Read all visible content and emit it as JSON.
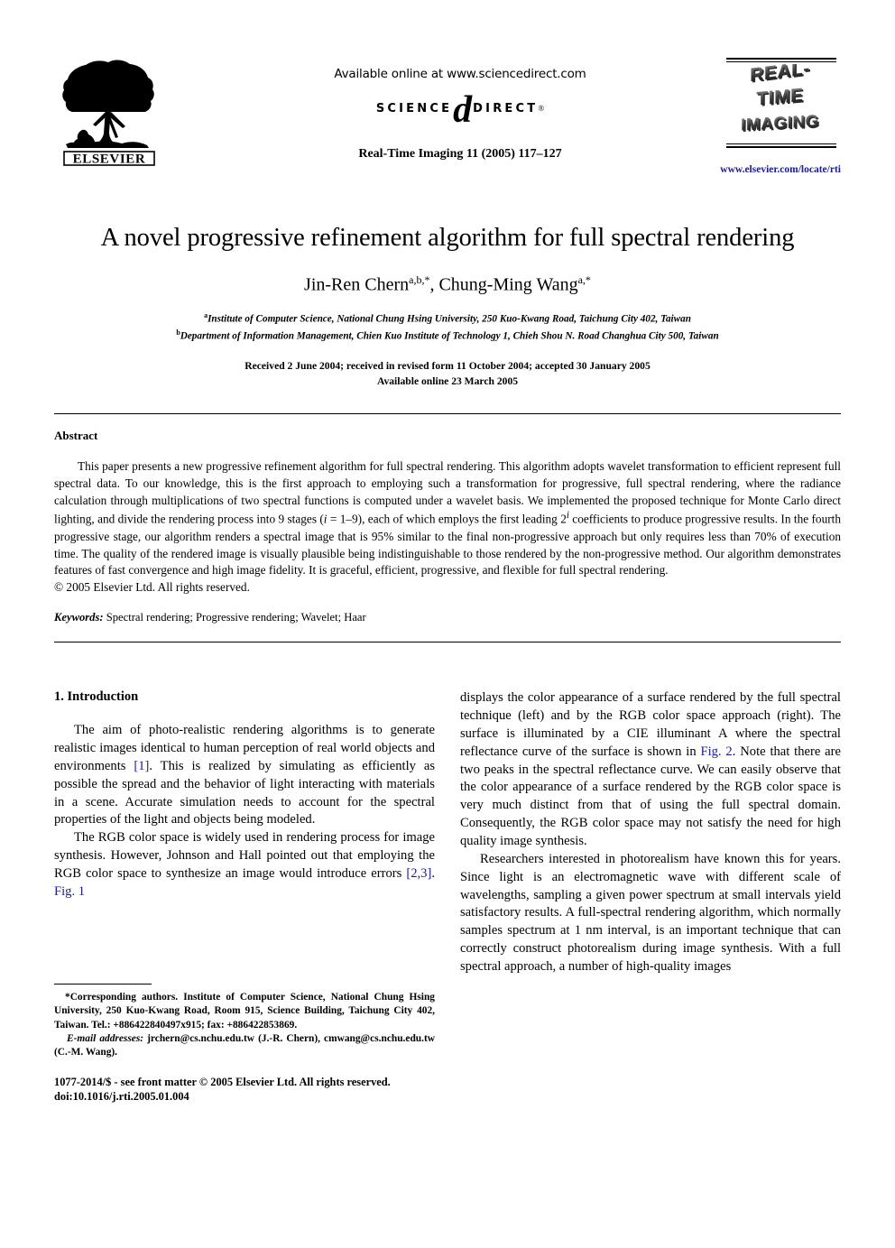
{
  "header": {
    "available_online": "Available online at www.sciencedirect.com",
    "sciencedirect_left": "SCIENCE",
    "sciencedirect_d": "d",
    "sciencedirect_right": "DIRECT",
    "sciencedirect_reg": "®",
    "journal_reference": "Real-Time Imaging 11 (2005) 117–127",
    "elsevier_wordmark": "ELSEVIER",
    "journal_logo_lines": [
      "REAL-",
      "TIME",
      "IMAGING"
    ],
    "journal_url": "www.elsevier.com/locate/rti",
    "link_color": "#1a1aa6"
  },
  "article": {
    "title": "A novel progressive refinement algorithm for full spectral rendering",
    "authors_plain": "Jin-Ren Chern",
    "authors": [
      {
        "name": "Jin-Ren Chern",
        "sup": "a,b,*"
      },
      {
        "name": "Chung-Ming Wang",
        "sup": "a,*"
      }
    ],
    "affiliations": [
      {
        "marker": "a",
        "text": "Institute of Computer Science, National Chung Hsing University, 250 Kuo-Kwang Road, Taichung City 402, Taiwan"
      },
      {
        "marker": "b",
        "text": "Department of Information Management, Chien Kuo Institute of Technology 1, Chieh Shou N. Road Changhua City 500, Taiwan"
      }
    ],
    "received_line": "Received 2 June 2004; received in revised form 11 October 2004; accepted 30 January 2005",
    "available_line": "Available online 23 March 2005"
  },
  "abstract": {
    "heading": "Abstract",
    "part1": "This paper presents a new progressive refinement algorithm for full spectral rendering. This algorithm adopts wavelet transformation to efficient represent full spectral data. To our knowledge, this is the first approach to employing such a transformation for progressive, full spectral rendering, where the radiance calculation through multiplications of two spectral functions is computed under a wavelet basis. We implemented the proposed technique for Monte Carlo direct lighting, and divide the rendering process into 9 stages (",
    "math_i": "i",
    "math_eq": " = 1–9), each of which employs the first leading 2",
    "math_sup": "i",
    "part2": " coefficients to produce progressive results. In the fourth progressive stage, our algorithm renders a spectral image that is 95% similar to the final non-progressive approach but only requires less than 70% of execution time. The quality of the rendered image is visually plausible being indistinguishable to those rendered by the non-progressive method. Our algorithm demonstrates features of fast convergence and high image fidelity. It is graceful, efficient, progressive, and flexible for full spectral rendering.",
    "copyright": "© 2005 Elsevier Ltd. All rights reserved.",
    "keywords_label": "Keywords:",
    "keywords_value": "Spectral rendering; Progressive rendering; Wavelet; Haar"
  },
  "body": {
    "section_heading": "1. Introduction",
    "left_column": {
      "para1_a": "The aim of photo-realistic rendering algorithms is to generate realistic images identical to human perception of real world objects and environments ",
      "para1_ref": "[1]",
      "para1_b": ". This is realized by simulating as efficiently as possible the spread and the behavior of light interacting with materials in a scene. Accurate simulation needs to account for the spectral properties of the light and objects being modeled.",
      "para2_a": "The RGB color space is widely used in rendering process for image synthesis. However, Johnson and Hall pointed out that employing the RGB color space to synthesize an image would introduce errors ",
      "para2_ref": "[2,3]",
      "para2_b": ". ",
      "para2_fig": "Fig. 1"
    },
    "right_column": {
      "para_cont_a": "displays the color appearance of a surface rendered by the full spectral technique (left) and by the RGB color space approach (right). The surface is illuminated by a CIE illuminant A where the spectral reflectance curve of the surface is shown in ",
      "para_cont_fig": "Fig. 2",
      "para_cont_b": ". Note that there are two peaks in the spectral reflectance curve. We can easily observe that the color appearance of a surface rendered by the RGB color space is very much distinct from that of using the full spectral domain. Consequently, the RGB color space may not satisfy the need for high quality image synthesis.",
      "para2": "Researchers interested in photorealism have known this for years. Since light is an electromagnetic wave with different scale of wavelengths, sampling a given power spectrum at small intervals yield satisfactory results. A full-spectral rendering algorithm, which normally samples spectrum at 1 nm interval, is an important technique that can correctly construct photorealism during image synthesis. With a full spectral approach, a number of high-quality images"
    }
  },
  "footnote": {
    "corresponding": "*Corresponding authors. Institute of Computer Science, National Chung Hsing University, 250 Kuo-Kwang Road, Room 915, Science Building, Taichung City 402, Taiwan. Tel.: +886422840497x915; fax: +886422853869.",
    "email_label": "E-mail addresses:",
    "email_value": "jrchern@cs.nchu.edu.tw (J.-R. Chern), cmwang@cs.nchu.edu.tw (C.-M. Wang)."
  },
  "footer": {
    "issn_line": "1077-2014/$ - see front matter © 2005 Elsevier Ltd. All rights reserved.",
    "doi_line": "doi:10.1016/j.rti.2005.01.004"
  }
}
